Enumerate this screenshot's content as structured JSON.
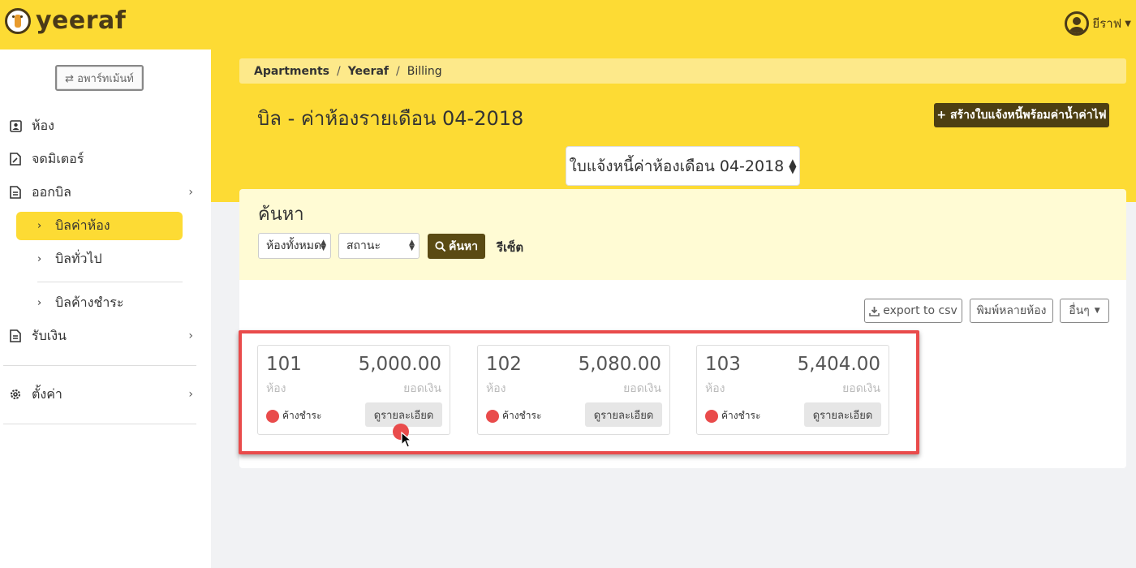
{
  "app": {
    "name": "yeeraf"
  },
  "user": {
    "name": "ยีราฟ"
  },
  "sidebar": {
    "apartments_button": "⇄ อพาร์ทเม้นท์",
    "items": [
      {
        "label": "ห้อง",
        "icon": "contact-card-icon"
      },
      {
        "label": "จดมิเตอร์",
        "icon": "edit-document-icon"
      },
      {
        "label": "ออกบิล",
        "icon": "document-icon"
      },
      {
        "label": "รับเงิน",
        "icon": "document-icon"
      },
      {
        "label": "ตั้งค่า",
        "icon": "gear-icon"
      }
    ],
    "billing_sub": [
      {
        "label": "บิลค่าห้อง",
        "active": true
      },
      {
        "label": "บิลทั่วไป",
        "active": false
      },
      {
        "label": "บิลค้างชำระ",
        "active": false
      }
    ]
  },
  "breadcrumb": [
    "Apartments",
    "Yeeraf",
    "Billing"
  ],
  "page": {
    "title": "บิล - ค่าห้องรายเดือน 04-2018",
    "create_button": "+ สร้างใบแจ้งหนี้พร้อมค่าน้ำค่าไฟ",
    "month_select": "ใบแจ้งหนี้ค่าห้องเดือน 04-2018"
  },
  "search": {
    "title": "ค้นหา",
    "room_select": "ห้องทั้งหมด",
    "status_select": "สถานะ",
    "search_button": "ค้นหา",
    "reset": "รีเซ็ต"
  },
  "toolbar": {
    "export": "export to csv",
    "print": "พิมพ์หลายห้อง",
    "more": "อื่นๆ"
  },
  "cards": [
    {
      "room": "101",
      "room_label": "ห้อง",
      "amount": "5,000.00",
      "amount_label": "ยอดเงิน",
      "status": "ค้างชำระ",
      "detail": "ดูรายละเอียด"
    },
    {
      "room": "102",
      "room_label": "ห้อง",
      "amount": "5,080.00",
      "amount_label": "ยอดเงิน",
      "status": "ค้างชำระ",
      "detail": "ดูรายละเอียด"
    },
    {
      "room": "103",
      "room_label": "ห้อง",
      "amount": "5,404.00",
      "amount_label": "ยอดเงิน",
      "status": "ค้างชำระ",
      "detail": "ดูรายละเอียด"
    }
  ],
  "colors": {
    "brand_yellow": "#fddb34",
    "brand_dark": "#4d3f12",
    "overdue_red": "#e94b4b"
  }
}
